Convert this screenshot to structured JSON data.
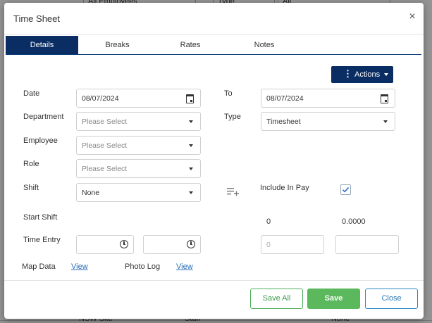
{
  "background": {
    "top_fields": [
      "All Employees",
      "Type",
      "All"
    ],
    "bottom_cells": [
      "NSW Site",
      "Staff",
      "None"
    ]
  },
  "modal": {
    "title": "Time Sheet",
    "close_glyph": "×",
    "tabs": [
      {
        "label": "Details",
        "active": true
      },
      {
        "label": "Breaks",
        "active": false
      },
      {
        "label": "Rates",
        "active": false
      },
      {
        "label": "Notes",
        "active": false
      }
    ],
    "actions_label": "Actions",
    "form": {
      "date_label": "Date",
      "date_value": "08/07/2024",
      "to_label": "To",
      "to_value": "08/07/2024",
      "department_label": "Department",
      "department_placeholder": "Please Select",
      "type_label": "Type",
      "type_value": "Timesheet",
      "employee_label": "Employee",
      "employee_placeholder": "Please Select",
      "role_label": "Role",
      "role_placeholder": "Please Select",
      "shift_label": "Shift",
      "shift_value": "None",
      "include_in_pay_label": "Include In Pay",
      "include_in_pay_checked": true,
      "start_shift_label": "Start Shift",
      "start_shift_hours": "0",
      "start_shift_amount": "0.0000",
      "time_entry_label": "Time Entry",
      "time_entry_start": "",
      "time_entry_end": "",
      "time_entry_hours_placeholder": "0",
      "time_entry_amount": "",
      "map_data_label": "Map Data",
      "map_data_link": "View",
      "photo_log_label": "Photo Log",
      "photo_log_link": "View"
    },
    "footer": {
      "save_all_label": "Save All",
      "save_label": "Save",
      "close_label": "Close"
    }
  },
  "colors": {
    "primary": "#0a2d63",
    "success": "#5cb85c",
    "info": "#2a85c8",
    "link": "#2a6db8"
  }
}
